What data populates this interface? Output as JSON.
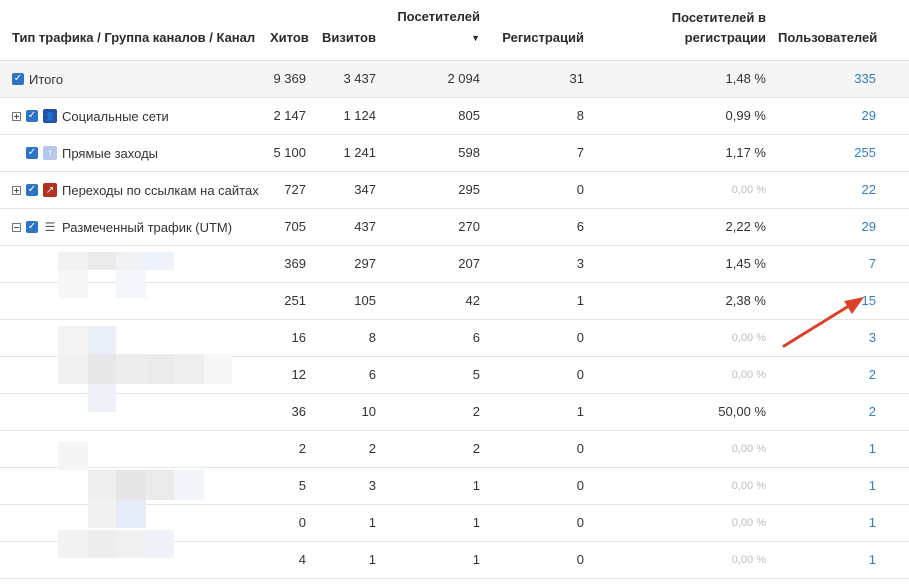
{
  "columns": [
    {
      "key": "name",
      "label": "Тип трафика / Группа каналов / Канал"
    },
    {
      "key": "hits",
      "label": "Хитов"
    },
    {
      "key": "visits",
      "label": "Визитов"
    },
    {
      "key": "visitors",
      "label": "Посетителей",
      "sort_icon": "sort-down-icon"
    },
    {
      "key": "regs",
      "label": "Регистраций"
    },
    {
      "key": "conv",
      "label": "Посетителей в регистрации"
    },
    {
      "key": "users",
      "label": "Пользователей"
    }
  ],
  "total": {
    "name": "Итого",
    "hits": "9 369",
    "visits": "3 437",
    "visitors": "2 094",
    "regs": "31",
    "conv": "1,48 %",
    "users": "335"
  },
  "groups": [
    {
      "name": "Социальные сети",
      "icon": "user-icon",
      "expander": "plus",
      "hits": "2 147",
      "visits": "1 124",
      "visitors": "805",
      "regs": "8",
      "conv": "0,99 %",
      "users": "29"
    },
    {
      "name": "Прямые заходы",
      "icon": "arrow-up-icon",
      "expander": "none",
      "hits": "5 100",
      "visits": "1 241",
      "visitors": "598",
      "regs": "7",
      "conv": "1,17 %",
      "users": "255"
    },
    {
      "name": "Переходы по ссылкам на сайтах",
      "icon": "external-link-icon",
      "expander": "plus",
      "hits": "727",
      "visits": "347",
      "visitors": "295",
      "regs": "0",
      "conv": "0,00 %",
      "users": "22"
    },
    {
      "name": "Размеченный трафик (UTM)",
      "icon": "list-icon",
      "expander": "minus",
      "hits": "705",
      "visits": "437",
      "visitors": "270",
      "regs": "6",
      "conv": "2,22 %",
      "users": "29"
    }
  ],
  "utm_rows": [
    {
      "hits": "369",
      "visits": "297",
      "visitors": "207",
      "regs": "3",
      "conv": "1,45 %",
      "users": "7"
    },
    {
      "hits": "251",
      "visits": "105",
      "visitors": "42",
      "regs": "1",
      "conv": "2,38 %",
      "users": "15"
    },
    {
      "hits": "16",
      "visits": "8",
      "visitors": "6",
      "regs": "0",
      "conv": "0,00 %",
      "users": "3"
    },
    {
      "hits": "12",
      "visits": "6",
      "visitors": "5",
      "regs": "0",
      "conv": "0,00 %",
      "users": "2"
    },
    {
      "hits": "36",
      "visits": "10",
      "visitors": "2",
      "regs": "1",
      "conv": "50,00 %",
      "users": "2"
    },
    {
      "hits": "2",
      "visits": "2",
      "visitors": "2",
      "regs": "0",
      "conv": "0,00 %",
      "users": "1"
    },
    {
      "hits": "5",
      "visits": "3",
      "visitors": "1",
      "regs": "0",
      "conv": "0,00 %",
      "users": "1"
    },
    {
      "hits": "0",
      "visits": "1",
      "visitors": "1",
      "regs": "0",
      "conv": "0,00 %",
      "users": "1"
    },
    {
      "hits": "4",
      "visits": "1",
      "visitors": "1",
      "regs": "0",
      "conv": "0,00 %",
      "users": "1"
    }
  ],
  "colors": {
    "accent": "#2f7fc2",
    "checkbox": "#2e74c6",
    "arrow": "#d9412b",
    "muted": "#bdbdbd"
  }
}
